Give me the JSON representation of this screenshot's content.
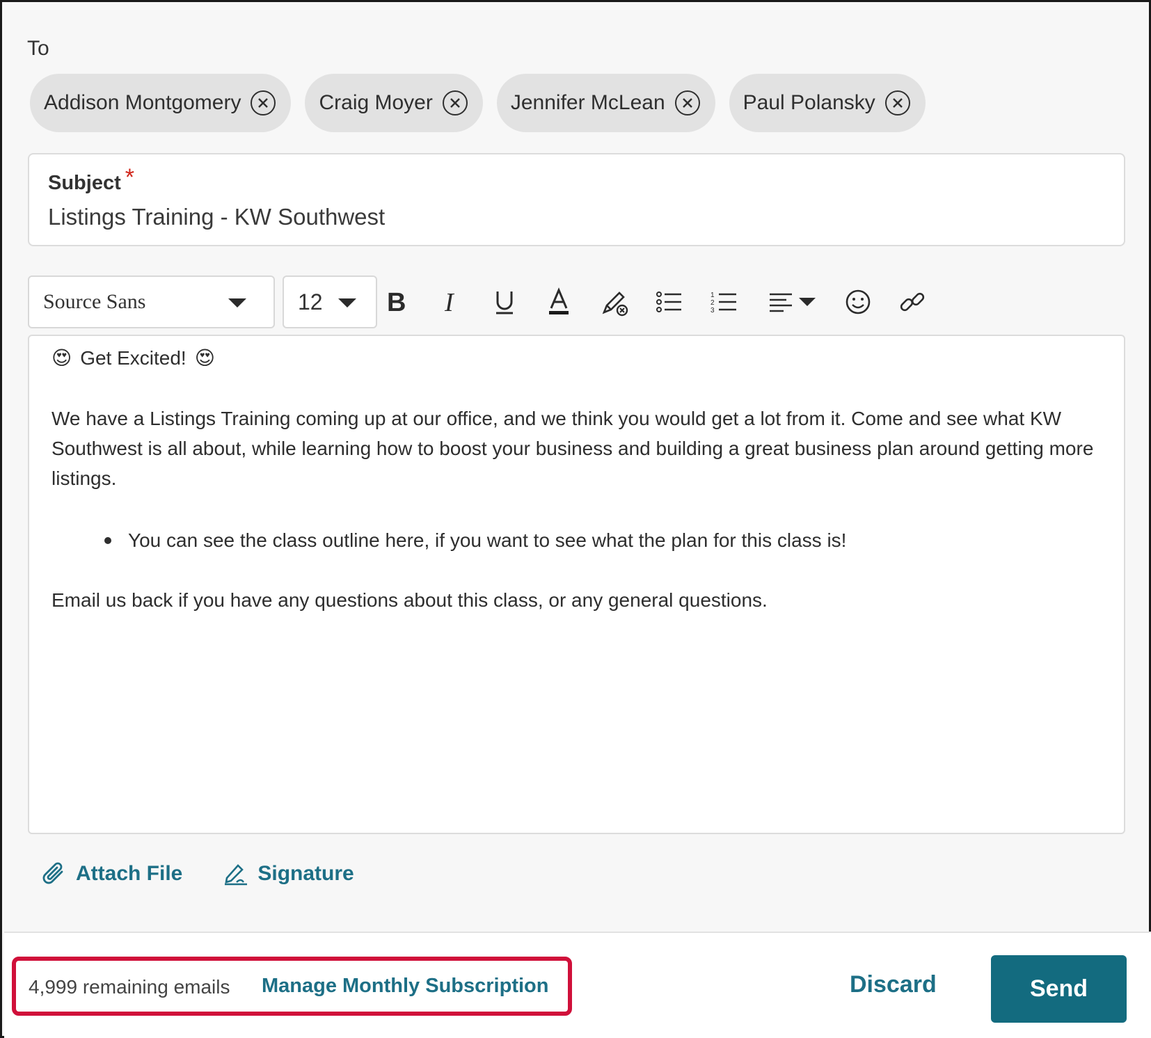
{
  "to": {
    "label": "To",
    "recipients": [
      {
        "name": "Addison Montgomery"
      },
      {
        "name": "Craig Moyer"
      },
      {
        "name": "Jennifer McLean"
      },
      {
        "name": "Paul Polansky"
      }
    ]
  },
  "subject": {
    "label": "Subject",
    "required_marker": "*",
    "value": "Listings Training - KW Southwest"
  },
  "toolbar": {
    "font_family": "Source Sans",
    "font_size": "12",
    "buttons": [
      "bold-icon",
      "italic-icon",
      "underline-icon",
      "text-color-icon",
      "clear-format-icon",
      "bullet-list-icon",
      "numbered-list-icon",
      "align-icon",
      "emoji-icon",
      "link-icon"
    ]
  },
  "body": {
    "emoji": "😍",
    "heading": "Get Excited!",
    "paragraph": "We have a Listings Training coming up at our office, and we think you would get a lot from it. Come and see what KW Southwest is all about, while learning how to boost your business and building a great business plan around getting more listings.",
    "bullet": "You can see the class outline here, if you want to see what the plan for this class is!",
    "closing": "Email us back if you have any questions about this class, or any general questions."
  },
  "actions": {
    "attach_label": "Attach File",
    "signature_label": "Signature"
  },
  "footer": {
    "remaining": "4,999 remaining emails",
    "manage_label": "Manage Monthly Subscription",
    "discard_label": "Discard",
    "send_label": "Send"
  },
  "colors": {
    "accent": "#1d6f86",
    "send_bg": "#136b7f",
    "highlight": "#d0103a",
    "required": "#d0261b",
    "chip_bg": "#e2e2e2"
  }
}
